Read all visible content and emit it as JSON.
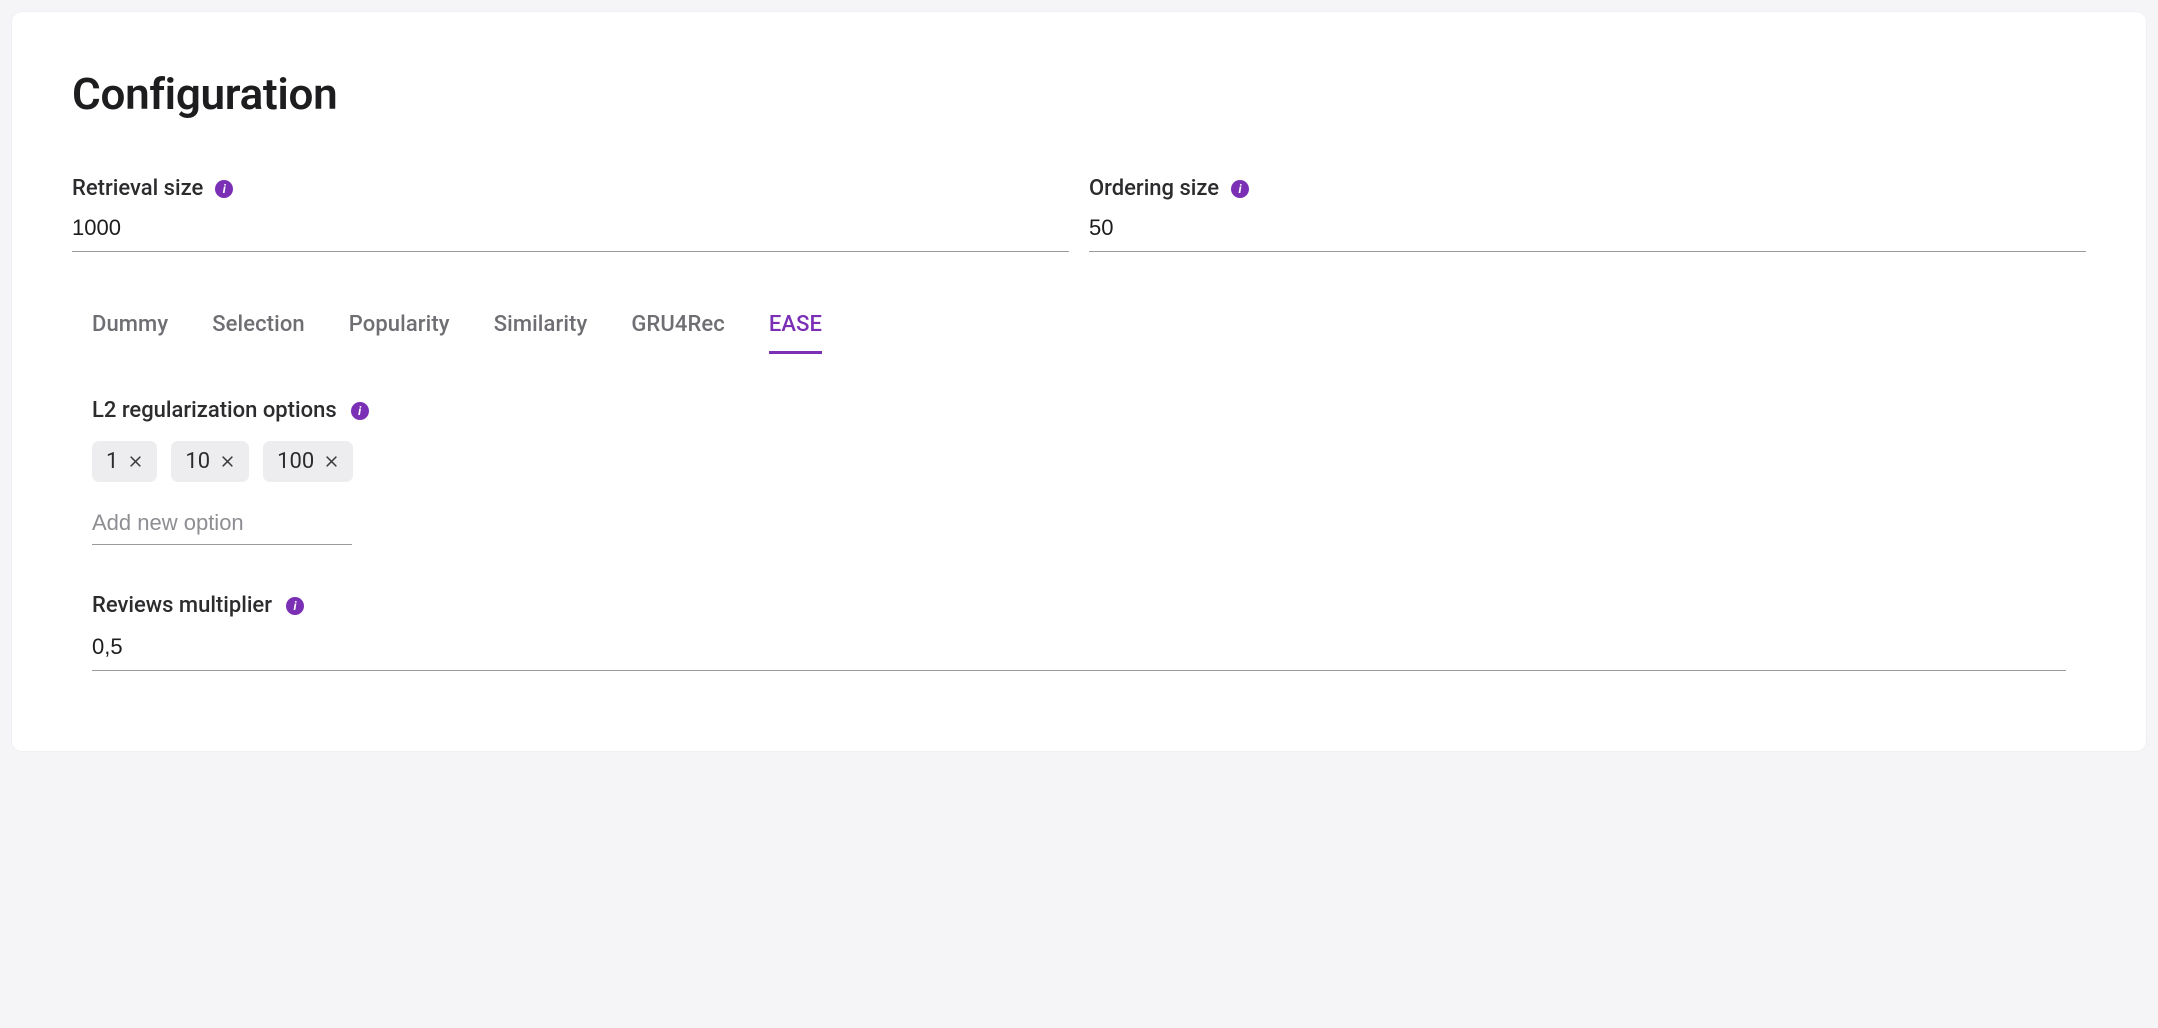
{
  "title": "Configuration",
  "fields": {
    "retrieval": {
      "label": "Retrieval size",
      "value": "1000"
    },
    "ordering": {
      "label": "Ordering size",
      "value": "50"
    }
  },
  "tabs": [
    {
      "label": "Dummy",
      "active": false
    },
    {
      "label": "Selection",
      "active": false
    },
    {
      "label": "Popularity",
      "active": false
    },
    {
      "label": "Similarity",
      "active": false
    },
    {
      "label": "GRU4Rec",
      "active": false
    },
    {
      "label": "EASE",
      "active": true
    }
  ],
  "l2": {
    "label": "L2 regularization options",
    "chips": [
      "1",
      "10",
      "100"
    ],
    "add_placeholder": "Add new option"
  },
  "multiplier": {
    "label": "Reviews multiplier",
    "value": "0,5"
  }
}
